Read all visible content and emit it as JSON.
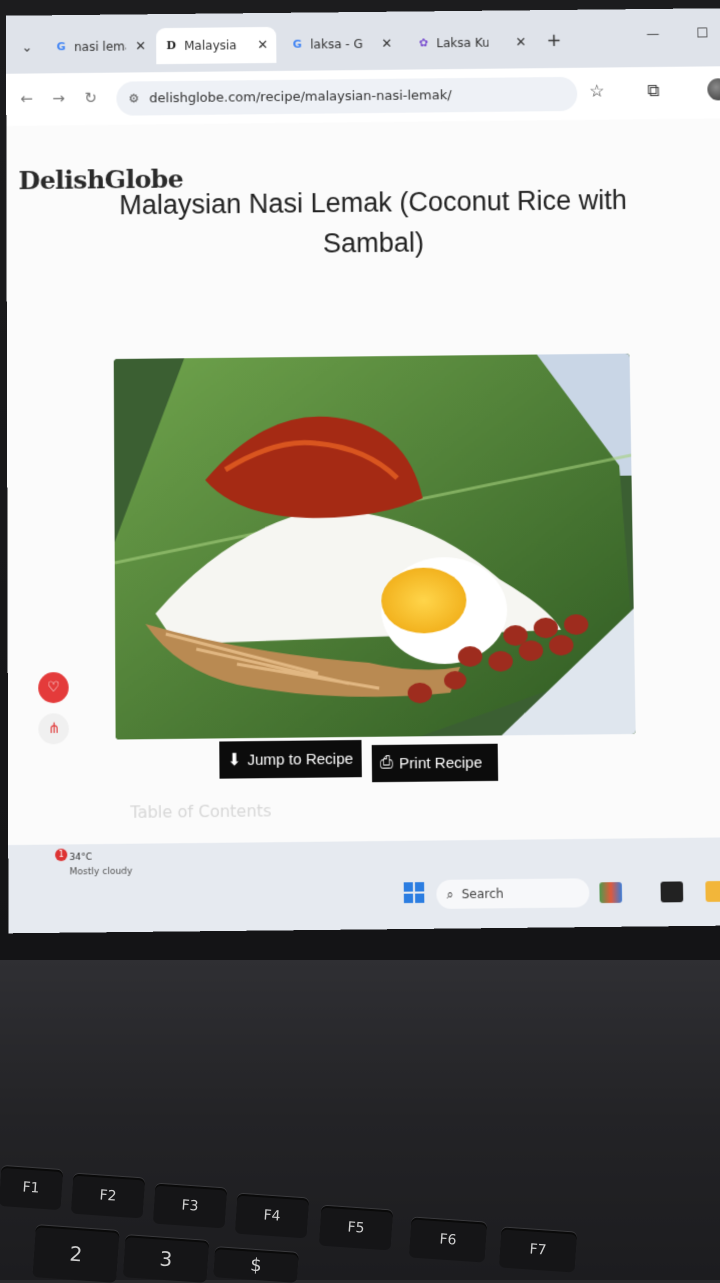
{
  "browser": {
    "tabs": [
      {
        "label": "nasi lemak",
        "favicon": "google-icon",
        "active": false
      },
      {
        "label": "Malaysian",
        "favicon": "delishglobe-icon",
        "active": true
      },
      {
        "label": "laksa - Go",
        "favicon": "google-icon",
        "active": false
      },
      {
        "label": "Laksa Kua",
        "favicon": "recipe-site-icon",
        "active": false
      }
    ],
    "url": "delishglobe.com/recipe/malaysian-nasi-lemak/"
  },
  "page": {
    "logo": "DelishGlobe",
    "title": "Malaysian Nasi Lemak (Coconut Rice with Sambal)",
    "hero_alt": "Nasi lemak with sambal anchovies, boiled egg and peanuts on banana leaf",
    "jump_label": "Jump to Recipe",
    "print_label": "Print Recipe",
    "toc_label": "Table of Contents"
  },
  "taskbar": {
    "weather_temp": "34°C",
    "weather_desc": "Mostly cloudy",
    "weather_badge": "1",
    "search_label": "Search"
  },
  "keyboard": {
    "fkeys": [
      "F1",
      "F2",
      "F3",
      "F4",
      "F5",
      "F6",
      "F7"
    ],
    "numkeys": [
      "2",
      "3",
      "$"
    ]
  },
  "colors": {
    "accent_red": "#e43b3b",
    "button_bg": "#0c0c0c",
    "windows_blue": "#2b7de1"
  }
}
